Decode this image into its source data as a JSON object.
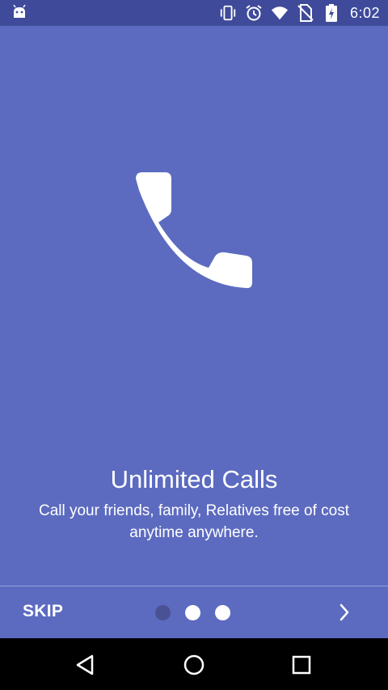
{
  "status_bar": {
    "time": "6:02",
    "icons": [
      "android-debug-icon",
      "vibrate-icon",
      "alarm-icon",
      "wifi-icon",
      "no-sim-icon",
      "battery-charging-icon"
    ]
  },
  "onboarding": {
    "icon": "phone-icon",
    "title": "Unlimited Calls",
    "description": "Call your friends, family, Relatives free of cost anytime anywhere.",
    "current_page": 1,
    "total_pages": 3
  },
  "controls": {
    "skip_label": "SKIP",
    "next_icon": "chevron-right-icon"
  },
  "nav_bar": {
    "buttons": [
      "back-icon",
      "home-icon",
      "recents-icon"
    ]
  },
  "colors": {
    "background": "#5c6bc0",
    "status_bar": "#3f4a9a",
    "active_dot": "#4a5296",
    "inactive_dot": "#ffffff",
    "text": "#ffffff"
  }
}
